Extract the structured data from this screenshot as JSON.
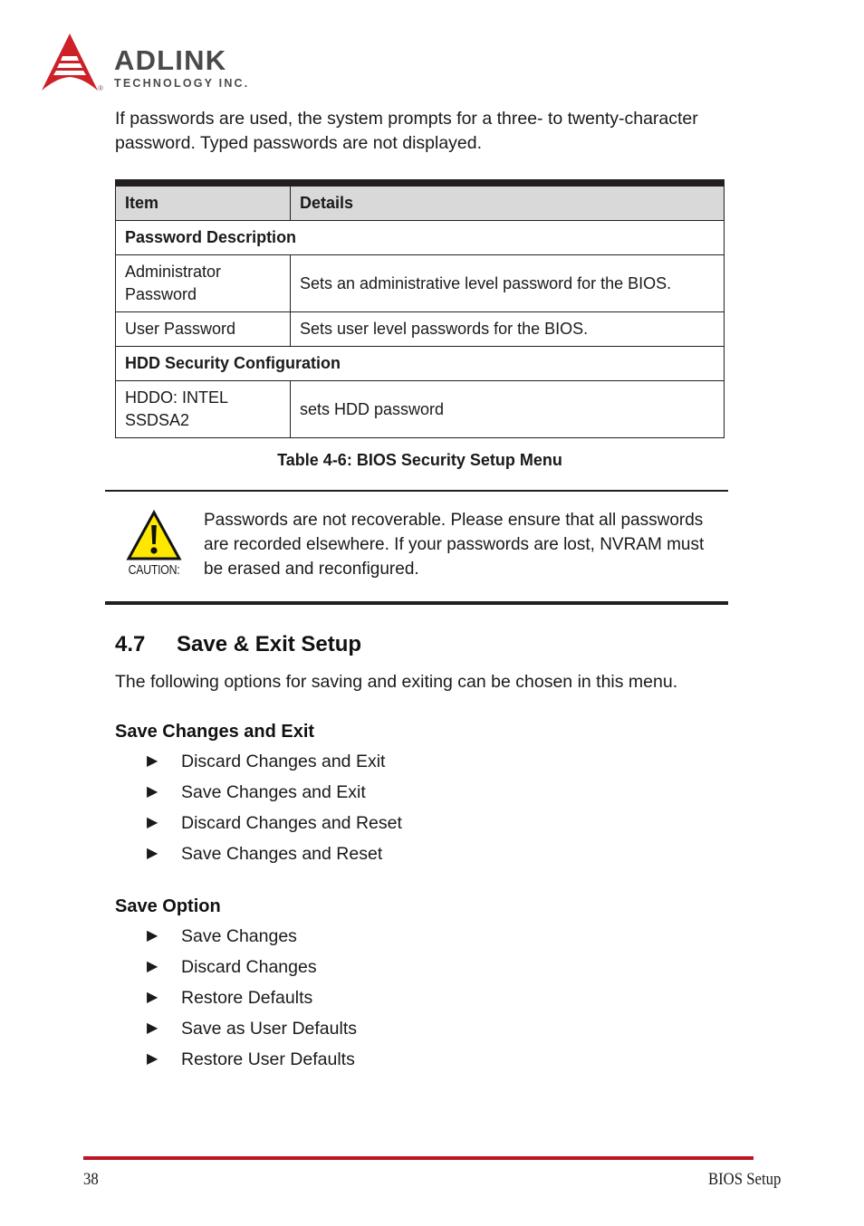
{
  "header": {
    "logo_name": "ADLINK",
    "logo_sub": "TECHNOLOGY INC.",
    "registered_mark": "®",
    "logo_color": "#CE2027",
    "wordmark_color": "#4A4A4D"
  },
  "intro": {
    "paragraph": "If passwords are used, the system prompts for a three- to twenty-character password. Typed passwords are not displayed."
  },
  "table": {
    "headers": [
      "Item",
      "Details"
    ],
    "header_bg": "#D9D9D9",
    "rows": [
      {
        "type": "section",
        "label": "Password Description"
      },
      {
        "type": "data",
        "item": "Administrator Password",
        "details": "Sets an administrative level password for the BIOS."
      },
      {
        "type": "data",
        "item": "User Password",
        "details": "Sets user level passwords for the BIOS."
      },
      {
        "type": "section",
        "label": "HDD Security Configuration"
      },
      {
        "type": "data",
        "item": "HDDO: INTEL SSDSA2",
        "details": "sets HDD password"
      }
    ],
    "caption": "Table  4-6: BIOS Security Setup Menu"
  },
  "caution": {
    "label": "CAUTION:",
    "icon_fill": "#FFE800",
    "text": "Passwords are not recoverable. Please ensure that all passwords are recorded elsewhere. If your passwords are lost, NVRAM must be erased and reconfigured."
  },
  "section": {
    "number": "4.7",
    "title": "Save & Exit Setup",
    "paragraph": "The following options for saving and exiting can be chosen in this menu."
  },
  "groups": [
    {
      "heading": "Save Changes and Exit",
      "items": [
        "Discard Changes and Exit",
        "Save Changes and Exit",
        "Discard Changes and Reset",
        "Save Changes and Reset"
      ]
    },
    {
      "heading": "Save Option",
      "items": [
        "Save Changes",
        "Discard Changes",
        "Restore Defaults",
        "Save as User Defaults",
        "Restore User Defaults"
      ]
    }
  ],
  "bullet_glyph": "▶",
  "footer": {
    "page_number": "38",
    "chapter": "BIOS Setup",
    "rule_color": "#BD1622"
  }
}
